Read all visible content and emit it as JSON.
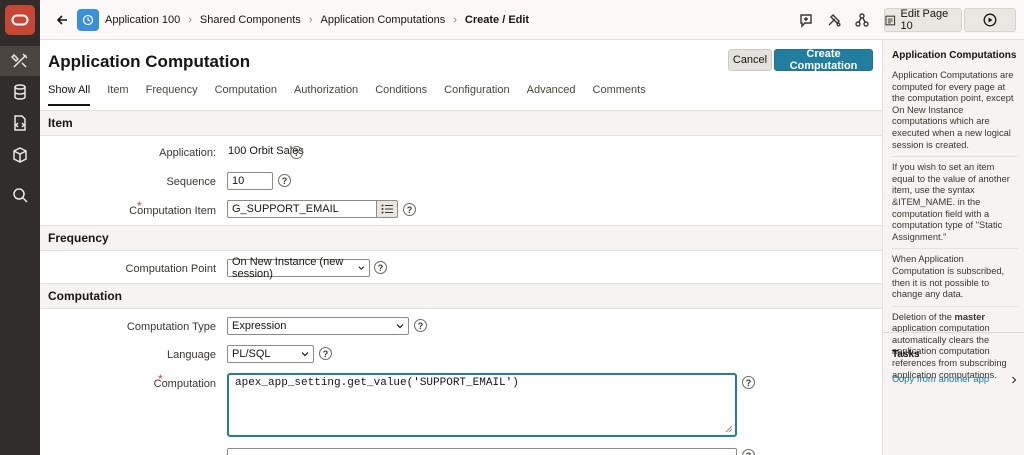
{
  "header": {
    "breadcrumbs": [
      {
        "label": "Application 100"
      },
      {
        "label": "Shared Components"
      },
      {
        "label": "Application Computations"
      },
      {
        "label": "Create / Edit"
      }
    ],
    "edit_page_label": "Edit Page 10"
  },
  "page": {
    "title": "Application Computation",
    "cancel_label": "Cancel",
    "create_label": "Create Computation"
  },
  "tabs": [
    {
      "label": "Show All",
      "active": true
    },
    {
      "label": "Item"
    },
    {
      "label": "Frequency"
    },
    {
      "label": "Computation"
    },
    {
      "label": "Authorization"
    },
    {
      "label": "Conditions"
    },
    {
      "label": "Configuration"
    },
    {
      "label": "Advanced"
    },
    {
      "label": "Comments"
    }
  ],
  "sections": {
    "item": {
      "heading": "Item",
      "application_label": "Application:",
      "application_value": "100 Orbit Sales",
      "sequence_label": "Sequence",
      "sequence_value": "10",
      "computation_item_label": "Computation Item",
      "computation_item_value": "G_SUPPORT_EMAIL"
    },
    "frequency": {
      "heading": "Frequency",
      "computation_point_label": "Computation Point",
      "computation_point_value": "On New Instance (new session)"
    },
    "computation": {
      "heading": "Computation",
      "type_label": "Computation Type",
      "type_value": "Expression",
      "language_label": "Language",
      "language_value": "PL/SQL",
      "computation_label": "Computation",
      "computation_value": "apex_app_setting.get_value('SUPPORT_EMAIL')"
    }
  },
  "help_panel": {
    "title": "Application Computations",
    "para1": "Application Computations are computed for every page at the computation point, except On New Instance computations which are executed when a new logical session is created.",
    "para2": "If you wish to set an item equal to the value of another item, use the syntax &ITEM_NAME. in the computation field with a computation type of \"Static Assignment.\"",
    "para3": "When Application Computation is subscribed, then it is not possible to change any data.",
    "para4_pre": "Deletion of the ",
    "para4_bold": "master",
    "para4_post": " application computation automatically clears the application computation references from subscribing application computations.",
    "tasks_title": "Tasks",
    "task_link": "Copy from another app"
  },
  "help_symbol": "?",
  "colors": {
    "rail_bg": "#312d2a",
    "oracle_red": "#c74634",
    "primary_button": "#227e9e",
    "app_icon": "#3a8fd9"
  },
  "icons": {
    "rail": [
      "oracle-logo-icon",
      "tools-icon",
      "database-icon",
      "sql-script-icon",
      "package-icon",
      "search-icon"
    ],
    "header": [
      "back-arrow-icon",
      "app-icon",
      "feedback-icon",
      "team-development-icon",
      "shared-components-icon",
      "edit-page-icon",
      "run-icon"
    ]
  }
}
